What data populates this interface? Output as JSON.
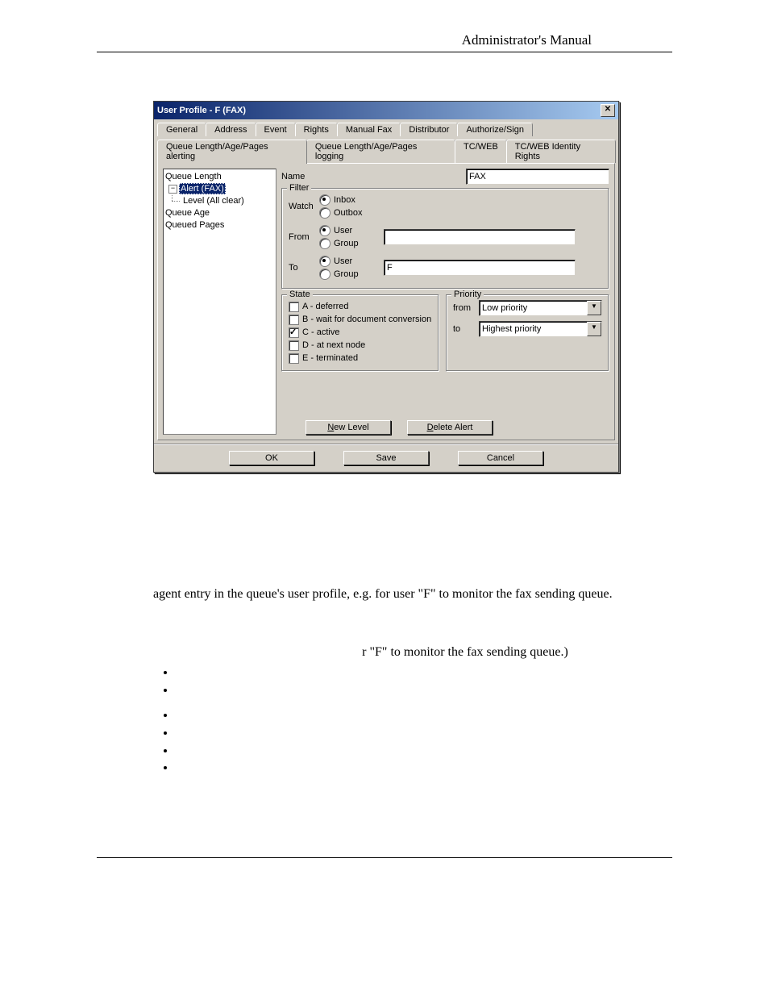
{
  "page_header": "Administrator's Manual",
  "dialog": {
    "title": "User Profile - F (FAX)",
    "tabs_row1": [
      "General",
      "Address",
      "Event",
      "Rights",
      "Manual Fax",
      "Distributor",
      "Authorize/Sign"
    ],
    "tabs_row2": [
      "Queue Length/Age/Pages alerting",
      "Queue Length/Age/Pages logging",
      "TC/WEB",
      "TC/WEB Identity Rights"
    ],
    "active_tab": "Queue Length/Age/Pages alerting",
    "tree": {
      "root1": "Queue Length",
      "alert": "Alert (FAX)",
      "level": "Level (All clear)",
      "root2": "Queue Age",
      "root3": "Queued Pages"
    },
    "labels": {
      "name": "Name",
      "filter": "Filter",
      "watch": "Watch",
      "from": "From",
      "to": "To",
      "state": "State",
      "priority": "Priority",
      "p_from": "from",
      "p_to": "to"
    },
    "name_value": "FAX",
    "watch_opts": {
      "inbox": "Inbox",
      "outbox": "Outbox"
    },
    "from_opts": {
      "user": "User",
      "group": "Group"
    },
    "to_opts": {
      "user": "User",
      "group": "Group"
    },
    "to_value": "F",
    "state_opts": {
      "a": "A - deferred",
      "b": "B - wait for document conversion",
      "c": "C - active",
      "d": "D - at next node",
      "e": "E - terminated"
    },
    "priority": {
      "from": "Low priority",
      "to": "Highest priority"
    },
    "buttons": {
      "new_level": "New Level",
      "delete_alert": "Delete Alert",
      "ok": "OK",
      "save": "Save",
      "cancel": "Cancel"
    }
  },
  "doc": {
    "line1": "agent entry in the queue's user profile, e.g. for user \"F\" to monitor the fax sending queue.",
    "line2": "r \"F\" to monitor the fax sending queue.)"
  }
}
